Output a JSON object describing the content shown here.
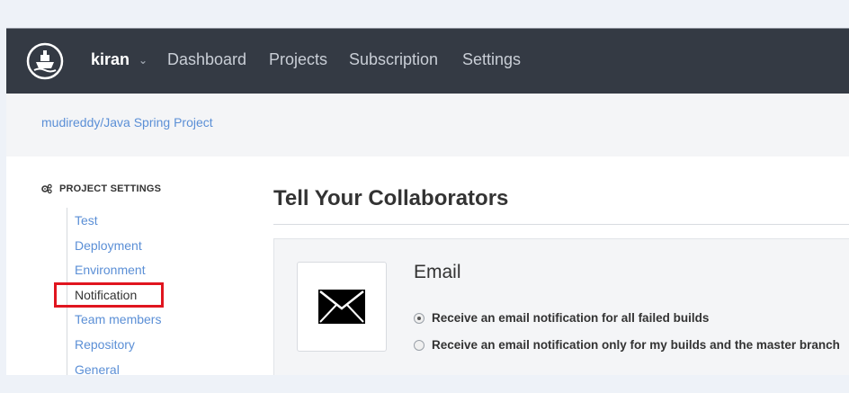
{
  "navbar": {
    "user": "kiran",
    "links": [
      "Dashboard",
      "Projects",
      "Subscription",
      "Settings"
    ]
  },
  "breadcrumb": "mudireddy/Java Spring Project",
  "sidebar": {
    "title": "PROJECT SETTINGS",
    "items": [
      "Test",
      "Deployment",
      "Environment",
      "Notification",
      "Team members",
      "Repository",
      "General"
    ],
    "active": "Notification"
  },
  "main": {
    "heading": "Tell Your Collaborators",
    "email": {
      "title": "Email",
      "options": [
        {
          "label": "Receive an email notification for all failed builds",
          "checked": true
        },
        {
          "label": "Receive an email notification only for my builds and the master branch",
          "checked": false
        }
      ]
    }
  },
  "icons": {
    "logo": "ship-logo-icon",
    "user_menu": "chevron-down-icon",
    "settings": "gears-icon",
    "email": "envelope-icon"
  },
  "colors": {
    "navbar_bg": "#343a44",
    "link": "#5b8fd6",
    "highlight": "#e0151f"
  }
}
